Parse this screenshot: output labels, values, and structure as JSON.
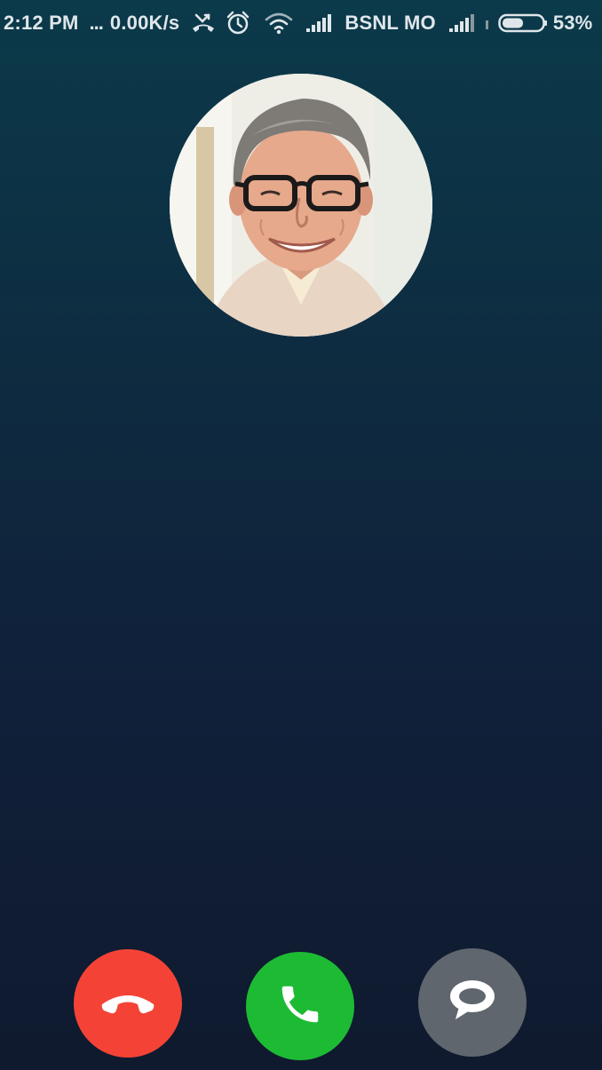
{
  "status_bar": {
    "time": "2:12 PM",
    "dots": "...",
    "net_speed": "0.00K/s",
    "carrier": "BSNL MO",
    "battery_percent": "53%",
    "battery_level": 0.53,
    "icons": [
      "missed-call-icon",
      "alarm-icon",
      "wifi-icon",
      "signal-icon",
      "signal-icon",
      "battery-icon"
    ]
  },
  "caller": {
    "avatar_icon": "caller-photo"
  },
  "actions": {
    "decline": {
      "icon": "hang-up-icon",
      "color": "#f44336"
    },
    "accept": {
      "icon": "phone-icon",
      "color": "#1dbb34"
    },
    "message": {
      "icon": "message-icon",
      "color": "#5f666d"
    }
  },
  "colors": {
    "background_top": "#0b3a4a",
    "background_bottom": "#0f1a2e",
    "status_text": "#dfe6ea"
  }
}
